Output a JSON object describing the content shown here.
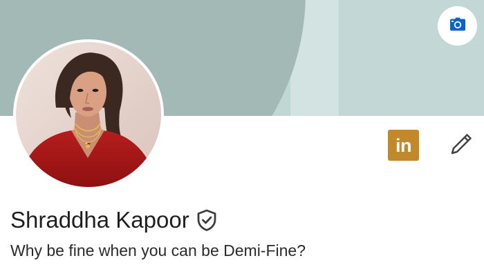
{
  "cover": {
    "colors": {
      "blob": "#a2b9b5",
      "base": "#c0d7d4",
      "light_band": "#d3e3e1"
    },
    "camera_button": {
      "icon": "camera-icon",
      "color": "#0a66c2"
    }
  },
  "profile": {
    "avatar_alt": "Profile photo",
    "name": "Shraddha Kapoor",
    "verified_icon": "shield-check-icon",
    "headline": "Why be fine when you can be Demi-Fine?"
  },
  "actions": {
    "linkedin_badge": {
      "text": "in",
      "color": "#c1892a"
    },
    "edit": {
      "icon": "pencil-icon"
    }
  }
}
